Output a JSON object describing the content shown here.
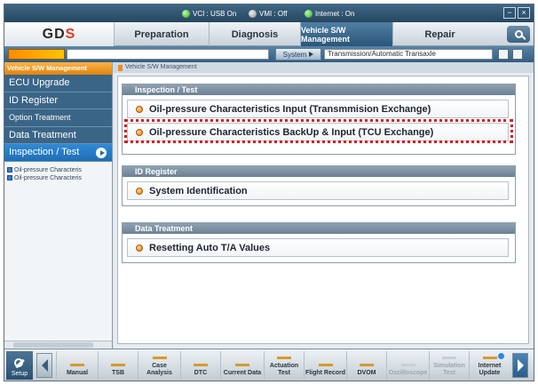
{
  "status": {
    "vci": "VCI : USB On",
    "vmi": "VMI : Off",
    "internet": "Internet : On"
  },
  "window": {
    "minimize": "−",
    "close": "×"
  },
  "tabs": [
    {
      "label": "Preparation",
      "active": false
    },
    {
      "label": "Diagnosis",
      "active": false
    },
    {
      "label": "Vehicle S/W Management",
      "active": true
    },
    {
      "label": "Repair",
      "active": false
    }
  ],
  "toolbar": {
    "system_label": "System",
    "system_value": "Transmission/Automatic Transaxle"
  },
  "sidebar": {
    "header": "Vehicle S/W Management",
    "items": [
      {
        "label": "ECU Upgrade",
        "active": false
      },
      {
        "label": "ID Register",
        "active": false
      },
      {
        "label": "Option Treatment",
        "active": false
      },
      {
        "label": "Data Treatment",
        "active": false
      },
      {
        "label": "Inspection / Test",
        "active": true
      }
    ],
    "docs": [
      "Oil-pressure Characteris",
      "Oil-pressure Characteris"
    ]
  },
  "main": {
    "breadcrumb": "Vehicle S/W Management",
    "groups": [
      {
        "title": "Inspection / Test",
        "options": [
          "Oil-pressure Characteristics Input (Transmmision Exchange)",
          "Oil-pressure Characteristics BackUp & Input (TCU Exchange)"
        ]
      },
      {
        "title": "ID Register",
        "options": [
          "System Identification"
        ]
      },
      {
        "title": "Data Treatment",
        "options": [
          "Resetting Auto T/A Values"
        ]
      }
    ]
  },
  "bottombar": {
    "setup": "Setup",
    "buttons": [
      {
        "label": "Manual",
        "enabled": true
      },
      {
        "label": "TSB",
        "enabled": true
      },
      {
        "label": "Case Analysis",
        "enabled": true
      },
      {
        "label": "DTC",
        "enabled": true
      },
      {
        "label": "Current Data",
        "enabled": true
      },
      {
        "label": "Actuation Test",
        "enabled": true
      },
      {
        "label": "Flight Record",
        "enabled": true
      },
      {
        "label": "DVOM",
        "enabled": true
      },
      {
        "label": "Oscilloscope",
        "enabled": false
      },
      {
        "label": "Simulation Test",
        "enabled": false
      },
      {
        "label": "Internet Update",
        "enabled": true
      }
    ]
  },
  "colors": {
    "accent": "#2b5679",
    "highlight": "#e01414",
    "bullet": "#e57c10"
  }
}
